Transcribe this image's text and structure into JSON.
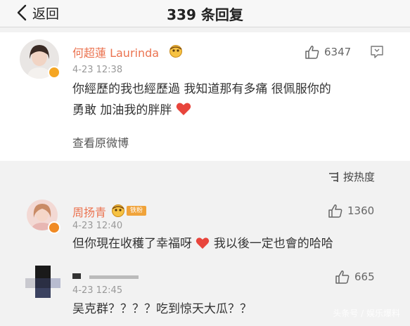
{
  "header": {
    "back_label": "返回",
    "title": "339 条回复"
  },
  "main_comment": {
    "author": "何超蓮 Laurinda",
    "time": "4-23 12:38",
    "likes": "6347",
    "text_line1": "你經歷的我也經歷過 我知道那有多痛 很佩服你的",
    "text_line2": "勇敢 加油我的胖胖",
    "view_original": "查看原微博"
  },
  "sort": {
    "label": "按热度"
  },
  "replies": [
    {
      "author": "周扬青",
      "fan_badge": "铁粉",
      "time": "4-23 12:40",
      "likes": "1360",
      "text_a": "但你現在收穫了幸福呀",
      "text_b": "我以後一定也會的哈哈"
    },
    {
      "author": "",
      "time": "4-23 12:45",
      "likes": "665",
      "text": "吴克群？？？？吃到惊天大瓜？？"
    }
  ],
  "watermark": "头条号 / 娱乐爆料",
  "colors": {
    "name_orange": "#eb7350",
    "heart_red": "#e8453c",
    "verify_yellow": "#f5a623"
  }
}
